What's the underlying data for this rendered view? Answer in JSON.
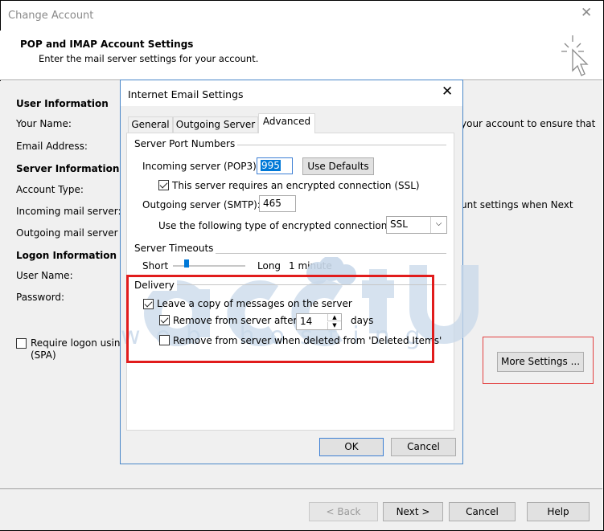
{
  "outer_window": {
    "title": "Change Account",
    "header_title": "POP and IMAP Account Settings",
    "header_subtitle": "Enter the mail server settings for your account.",
    "sections": {
      "user_information": "User Information",
      "your_name": "Your Name:",
      "email_address": "Email Address:",
      "server_information": "Server Information",
      "account_type": "Account Type:",
      "incoming_mail_server": "Incoming mail server:",
      "outgoing_mail_server": "Outgoing mail server (S",
      "logon_information": "Logon Information",
      "user_name": "User Name:",
      "password": "Password:",
      "require_logon": "Require logon usin",
      "spa": "(SPA)"
    },
    "right_text_1": "your account to ensure that",
    "right_text_2": "unt settings when Next",
    "more_settings_label": "More Settings ...",
    "footer_buttons": {
      "back": "< Back",
      "next": "Next >",
      "cancel": "Cancel",
      "help": "Help"
    }
  },
  "dialog": {
    "title": "Internet Email Settings",
    "tabs": [
      "General",
      "Outgoing Server",
      "Advanced"
    ],
    "active_tab": "Advanced",
    "server_port_numbers": {
      "group_label": "Server Port Numbers",
      "incoming_label": "Incoming server (POP3):",
      "incoming_value": "995",
      "use_defaults": "Use Defaults",
      "ssl_checkbox_label": "This server requires an encrypted connection (SSL)",
      "ssl_checked": true,
      "outgoing_label": "Outgoing server (SMTP):",
      "outgoing_value": "465",
      "encryption_label": "Use the following type of encrypted connection:",
      "encryption_value": "SSL"
    },
    "server_timeouts": {
      "group_label": "Server Timeouts",
      "short": "Short",
      "long": "Long",
      "value": "1 minute",
      "slider_level": 0.08
    },
    "delivery": {
      "group_label": "Delivery",
      "leave_copy": "Leave a copy of messages on the server",
      "leave_copy_checked": true,
      "remove_after": "Remove from server after",
      "remove_after_checked": true,
      "days_value": "14",
      "days_label": "days",
      "remove_deleted": "Remove from server when deleted from 'Deleted Items'",
      "remove_deleted_checked": false
    },
    "ok": "OK",
    "cancel": "Cancel"
  },
  "watermark": {
    "brand": "acctu",
    "tagline": "web hosting"
  },
  "colors": {
    "highlight_red": "#e11c1c",
    "focus_blue": "#3c7fd4",
    "watermark": "#c9d9ea"
  }
}
